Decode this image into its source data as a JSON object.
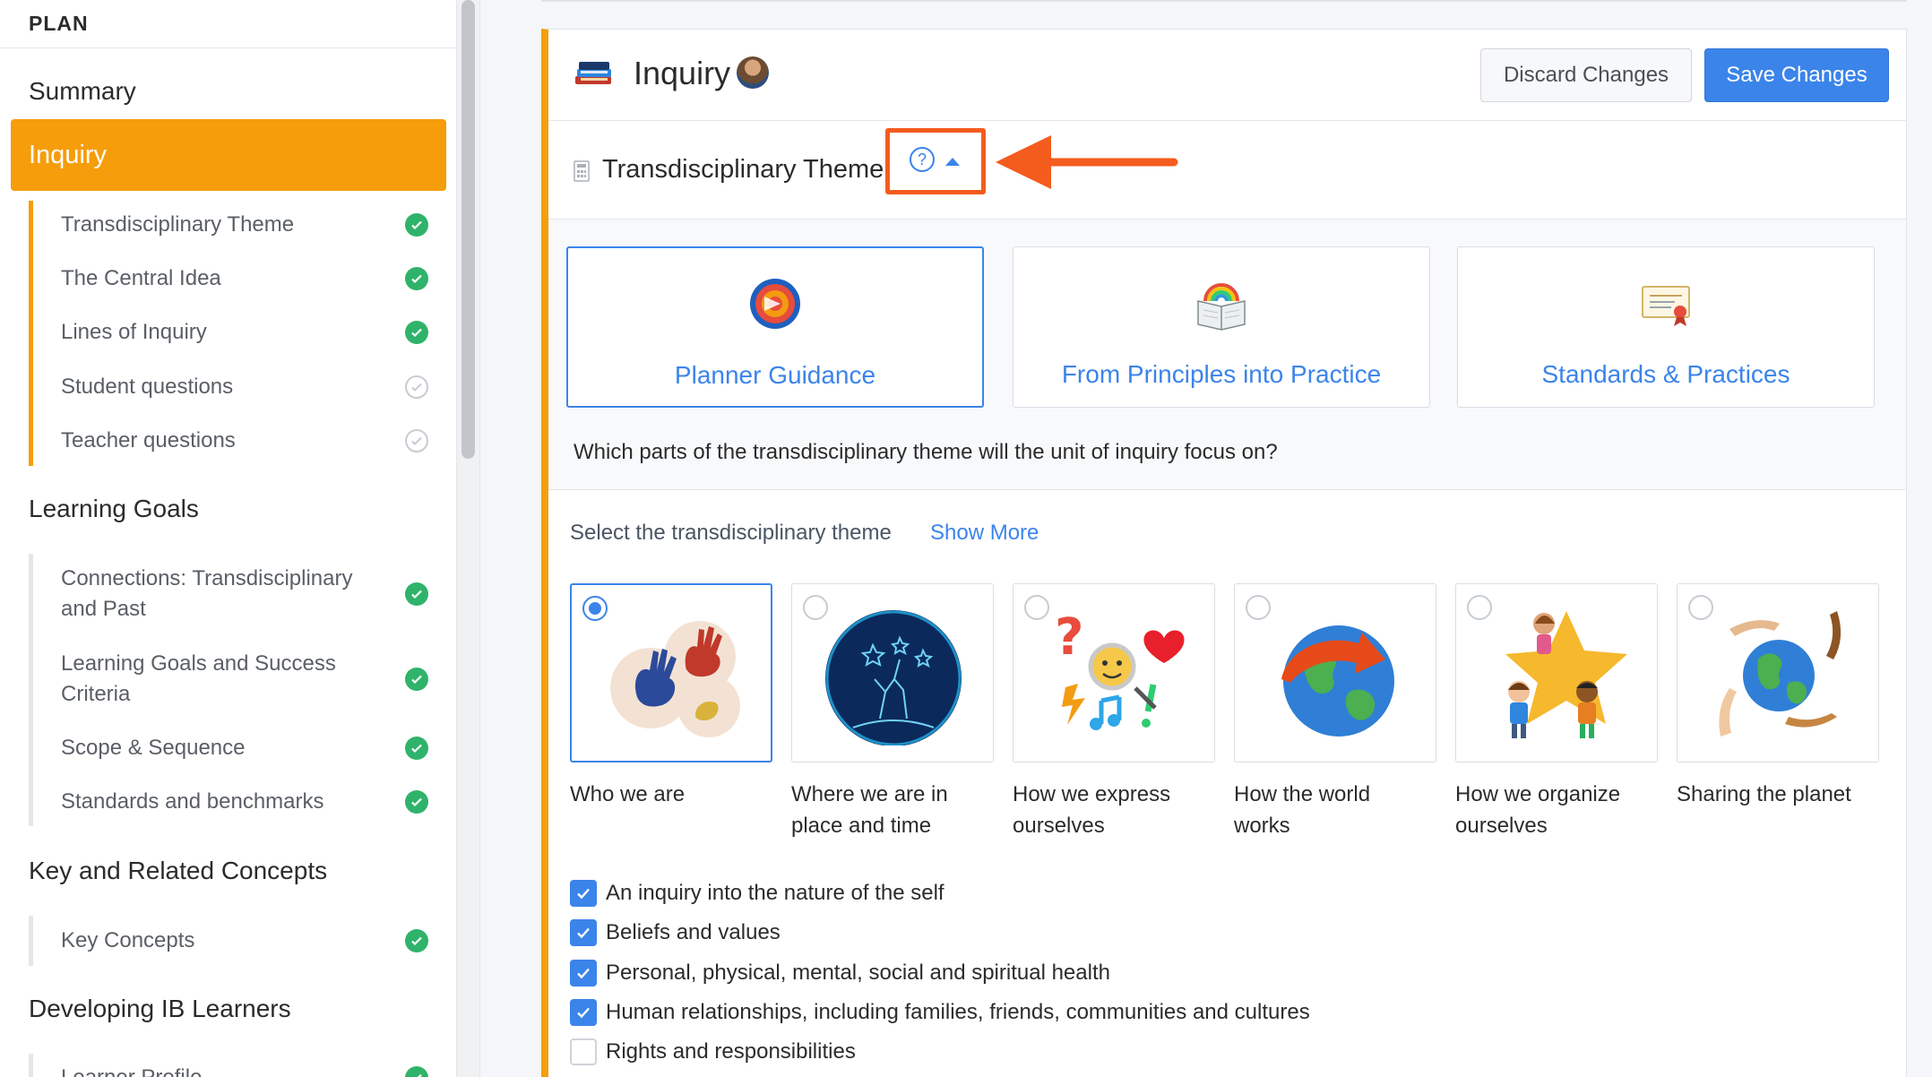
{
  "sidebar": {
    "header": "PLAN",
    "summary": "Summary",
    "inquiry": "Inquiry",
    "inquiry_items": [
      {
        "label": "Transdisciplinary Theme",
        "done": true
      },
      {
        "label": "The Central Idea",
        "done": true
      },
      {
        "label": "Lines of Inquiry",
        "done": true
      },
      {
        "label": "Student questions",
        "done": false
      },
      {
        "label": "Teacher questions",
        "done": false
      }
    ],
    "learning_goals": "Learning Goals",
    "learning_items": [
      {
        "label": "Connections: Transdisciplinary and Past",
        "done": true
      },
      {
        "label": "Learning Goals and Success Criteria",
        "done": true
      },
      {
        "label": "Scope & Sequence",
        "done": true
      },
      {
        "label": "Standards and benchmarks",
        "done": true
      }
    ],
    "key_concepts_section": "Key and Related Concepts",
    "key_items": [
      {
        "label": "Key Concepts",
        "done": true
      }
    ],
    "ib_learners": "Developing IB Learners",
    "ib_items": [
      {
        "label": "Learner Profile",
        "done": true
      }
    ]
  },
  "main": {
    "title": "Inquiry",
    "discard_label": "Discard Changes",
    "save_label": "Save Changes",
    "theme_title": "Transdisciplinary Theme",
    "help_glyph": "?",
    "cards": [
      {
        "label": "Planner Guidance",
        "icon": "target-icon"
      },
      {
        "label": "From Principles into Practice",
        "icon": "book-rainbow-icon"
      },
      {
        "label": "Standards & Practices",
        "icon": "certificate-icon"
      }
    ],
    "question": "Which parts of the transdisciplinary theme will the unit of inquiry focus on?",
    "select_label": "Select the transdisciplinary theme",
    "show_more": "Show More",
    "themes": [
      {
        "label": "Who we are",
        "selected": true
      },
      {
        "label": "Where we are in place and time",
        "selected": false
      },
      {
        "label": "How we express ourselves",
        "selected": false
      },
      {
        "label": "How the world works",
        "selected": false
      },
      {
        "label": "How we organize ourselves",
        "selected": false
      },
      {
        "label": "Sharing the planet",
        "selected": false
      }
    ],
    "focus_options": [
      {
        "label": "An inquiry into the nature of the self",
        "checked": true
      },
      {
        "label": "Beliefs and values",
        "checked": true
      },
      {
        "label": "Personal, physical, mental, social and spiritual health",
        "checked": true
      },
      {
        "label": "Human relationships, including families, friends, communities and cultures",
        "checked": true
      },
      {
        "label": "Rights and responsibilities",
        "checked": false
      }
    ]
  },
  "colors": {
    "accent": "#f59d0b",
    "primary": "#3b84ea",
    "success": "#2fb36a",
    "annotation": "#f45c1e"
  }
}
